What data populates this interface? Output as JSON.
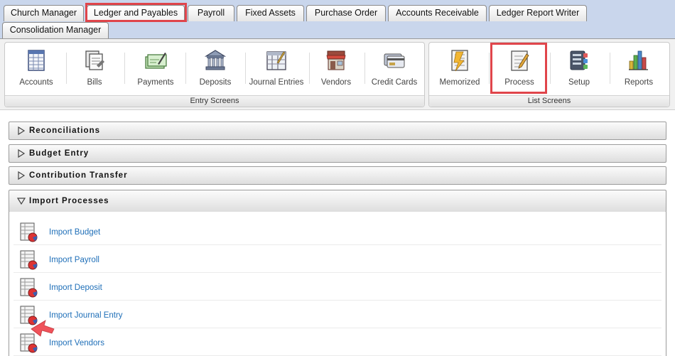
{
  "tabs": [
    {
      "label": "Church Manager"
    },
    {
      "label": "Ledger and Payables"
    },
    {
      "label": "Payroll"
    },
    {
      "label": "Fixed Assets"
    },
    {
      "label": "Purchase Order"
    },
    {
      "label": "Accounts Receivable"
    },
    {
      "label": "Ledger Report Writer"
    },
    {
      "label": "Consolidation Manager"
    }
  ],
  "entry_screens": {
    "label": "Entry Screens",
    "items": [
      {
        "label": "Accounts",
        "icon": "ledger-grid-icon"
      },
      {
        "label": "Bills",
        "icon": "bills-icon"
      },
      {
        "label": "Payments",
        "icon": "check-pen-icon"
      },
      {
        "label": "Deposits",
        "icon": "bank-icon"
      },
      {
        "label": "Journal Entries",
        "icon": "journal-icon"
      },
      {
        "label": "Vendors",
        "icon": "storefront-icon"
      },
      {
        "label": "Credit Cards",
        "icon": "credit-card-icon"
      }
    ]
  },
  "list_screens": {
    "label": "List Screens",
    "items": [
      {
        "label": "Memorized",
        "icon": "memorized-icon"
      },
      {
        "label": "Process",
        "icon": "process-icon"
      },
      {
        "label": "Setup",
        "icon": "setup-icon"
      },
      {
        "label": "Reports",
        "icon": "reports-icon"
      }
    ]
  },
  "sections": [
    {
      "title": "Reconciliations",
      "expanded": false
    },
    {
      "title": "Budget Entry",
      "expanded": false
    },
    {
      "title": "Contribution Transfer",
      "expanded": false
    },
    {
      "title": "Import Processes",
      "expanded": true
    }
  ],
  "import_processes": [
    {
      "label": "Import Budget"
    },
    {
      "label": "Import Payroll"
    },
    {
      "label": "Import Deposit"
    },
    {
      "label": "Import Journal Entry"
    },
    {
      "label": "Import Vendors"
    }
  ],
  "colors": {
    "tabbar_bg": "#c9d6ec",
    "highlight": "#e0454b",
    "link": "#1f6fb8"
  }
}
